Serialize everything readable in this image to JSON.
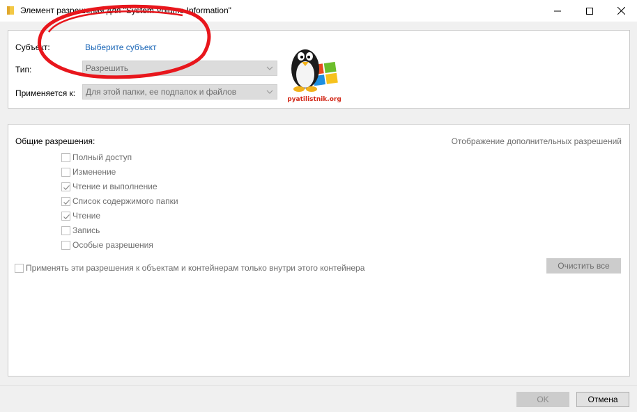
{
  "window": {
    "title": "Элемент разрешения для \"System Volume Information\"",
    "icon": "folder-icon",
    "controls": [
      "minimize-icon",
      "maximize-icon",
      "close-icon"
    ]
  },
  "principal": {
    "subject_label": "Субъект:",
    "subject_link": "Выберите субъект",
    "type_label": "Тип:",
    "type_value": "Разрешить",
    "applies_label": "Применяется к:",
    "applies_value": "Для этой папки, ее подпапок и файлов"
  },
  "watermark": {
    "text": "pyatilistnik.org",
    "image": "penguin-windows-logo"
  },
  "permissions": {
    "heading": "Общие разрешения:",
    "advanced_link": "Отображение дополнительных разрешений",
    "items": [
      {
        "label": "Полный доступ",
        "checked": false
      },
      {
        "label": "Изменение",
        "checked": false
      },
      {
        "label": "Чтение и выполнение",
        "checked": true
      },
      {
        "label": "Список содержимого папки",
        "checked": true
      },
      {
        "label": "Чтение",
        "checked": true
      },
      {
        "label": "Запись",
        "checked": false
      },
      {
        "label": "Особые разрешения",
        "checked": false
      }
    ],
    "apply_only_label": "Применять эти разрешения к объектам и контейнерам только внутри этого контейнера",
    "apply_only_checked": false,
    "clear_all_label": "Очистить все"
  },
  "footer": {
    "ok_label": "OK",
    "cancel_label": "Отмена"
  },
  "colors": {
    "link": "#1a66b7",
    "disabled_text": "#6d6d6d",
    "annotation": "#e8161c"
  }
}
